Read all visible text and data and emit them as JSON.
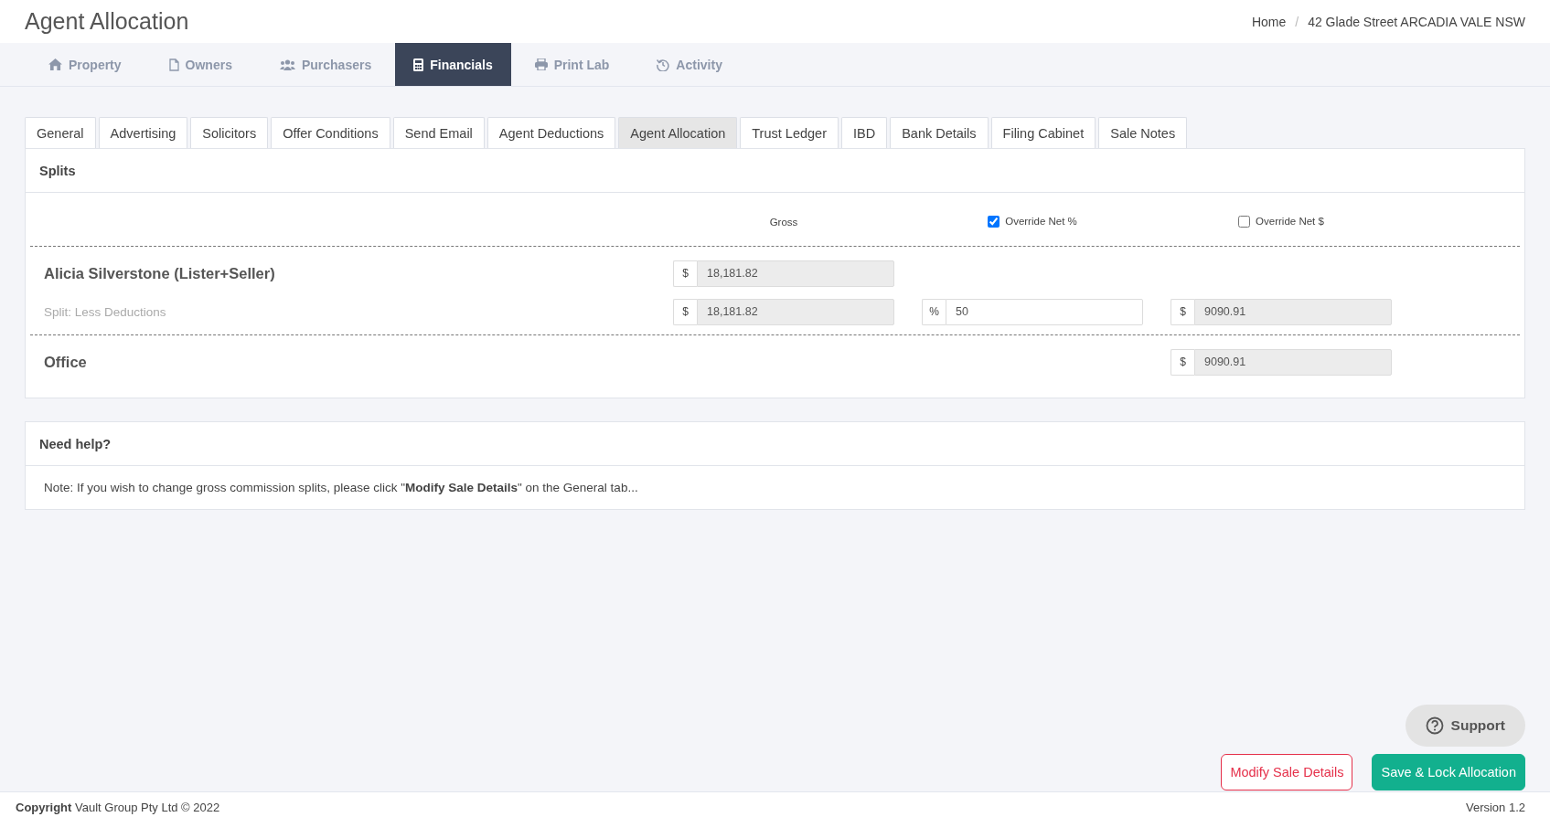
{
  "page_title": "Agent Allocation",
  "breadcrumb": {
    "separator": "/",
    "items": [
      {
        "label": "Home"
      },
      {
        "label": "42 Glade Street ARCADIA VALE NSW"
      }
    ]
  },
  "main_tabs": [
    {
      "label": "Property",
      "selected": false
    },
    {
      "label": "Owners",
      "selected": false
    },
    {
      "label": "Purchasers",
      "selected": false
    },
    {
      "label": "Financials",
      "selected": true
    },
    {
      "label": "Print Lab",
      "selected": false
    },
    {
      "label": "Activity",
      "selected": false
    }
  ],
  "sub_tabs": [
    {
      "label": "General",
      "selected": false
    },
    {
      "label": "Advertising",
      "selected": false
    },
    {
      "label": "Solicitors",
      "selected": false
    },
    {
      "label": "Offer Conditions",
      "selected": false
    },
    {
      "label": "Send Email",
      "selected": false
    },
    {
      "label": "Agent Deductions",
      "selected": false
    },
    {
      "label": "Agent Allocation",
      "selected": true
    },
    {
      "label": "Trust Ledger",
      "selected": false
    },
    {
      "label": "IBD",
      "selected": false
    },
    {
      "label": "Bank Details",
      "selected": false
    },
    {
      "label": "Filing Cabinet",
      "selected": false
    },
    {
      "label": "Sale Notes",
      "selected": false
    }
  ],
  "splits": {
    "title": "Splits",
    "columns": [
      {
        "label": "Gross",
        "kind": "plain"
      },
      {
        "label": "Override Net %",
        "kind": "checkbox",
        "checked": true
      },
      {
        "label": "Override Net $",
        "kind": "checkbox",
        "checked": false
      }
    ],
    "sections": [
      {
        "rows": [
          {
            "kind": "name",
            "label": "Alicia Silverstone (Lister+Seller)",
            "gross": {
              "prefix": "$",
              "value": "18,181.82",
              "disabled": true
            }
          },
          {
            "kind": "detail",
            "label": "Split: Less Deductions",
            "gross": {
              "prefix": "$",
              "value": "18,181.82",
              "disabled": true
            },
            "percent": {
              "prefix": "%",
              "value": "50",
              "disabled": false
            },
            "net": {
              "prefix": "$",
              "value": "9090.91",
              "disabled": true
            }
          }
        ]
      },
      {
        "rows": [
          {
            "kind": "name",
            "label": "Office",
            "net": {
              "prefix": "$",
              "value": "9090.91",
              "disabled": true
            }
          }
        ]
      }
    ]
  },
  "help": {
    "title": "Need help?",
    "note": "Note: If you wish to change gross commission splits, please click \"**Modify Sale Details**\" on the General tab..."
  },
  "support": {
    "label": "Support"
  },
  "buttons": [
    {
      "label": "Modify Sale Details",
      "kind": "outline"
    },
    {
      "label": "Save & Lock Allocation",
      "kind": "primary"
    }
  ],
  "footer": {
    "copyright": "**Copyright** Vault Group Pty Ltd © 2022",
    "version": "Version 1.2"
  }
}
